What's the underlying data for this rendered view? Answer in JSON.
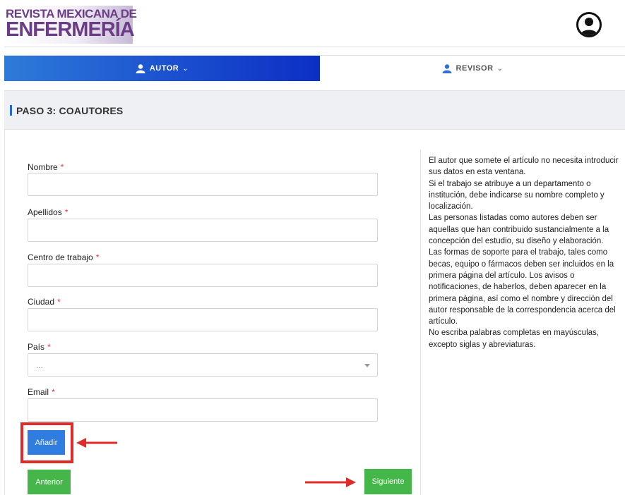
{
  "header": {
    "logo_line1": "REVISTA MEXICANA DE",
    "logo_line2": "ENFERMERÍA",
    "avatar_icon": "user-icon"
  },
  "nav": {
    "autor_label": "AUTOR",
    "revisor_label": "REVISOR",
    "icon": "user-icon",
    "chevron": "chevron-down-icon"
  },
  "step": {
    "title": "PASO 3: COAUTORES"
  },
  "form": {
    "required_mark": "*",
    "fields": {
      "nombre": {
        "label": "Nombre",
        "value": ""
      },
      "apellidos": {
        "label": "Apellidos",
        "value": ""
      },
      "centro": {
        "label": "Centro de trabajo",
        "value": ""
      },
      "ciudad": {
        "label": "Ciudad",
        "value": ""
      },
      "pais": {
        "label": "País",
        "selected": "..."
      },
      "email": {
        "label": "Email",
        "value": ""
      }
    },
    "add_button": "Añadir",
    "prev_button": "Anterior",
    "next_button": "Siguiente"
  },
  "info": {
    "paragraphs": [
      "El autor que somete el artículo no necesita introducir sus datos en esta ventana.",
      "Si el trabajo se atribuye a un departamento o institución, debe indicarse su nombre completo y localización.",
      "Las personas listadas como autores deben ser aquellas que han contribuido sustancialmente a la concepción del estudio, su diseño y elaboración.",
      "Las formas de soporte para el trabajo, tales como becas, equipo o fármacos deben ser incluidos en la primera página del artículo. Los avisos o notificaciones, de haberlos, deben aparecer en la primera página, así como el nombre y dirección del autor responsable de la correspondencia acerca del artículo.",
      "No escriba palabras completas en mayúsculas, excepto siglas y abreviaturas."
    ]
  },
  "colors": {
    "brand_purple": "#6b3d86",
    "nav_blue": "#1a4fcf",
    "button_green": "#45b649",
    "button_blue": "#2f7de1",
    "annotation_red": "#e02b2b",
    "required_red": "#e23b3b"
  }
}
